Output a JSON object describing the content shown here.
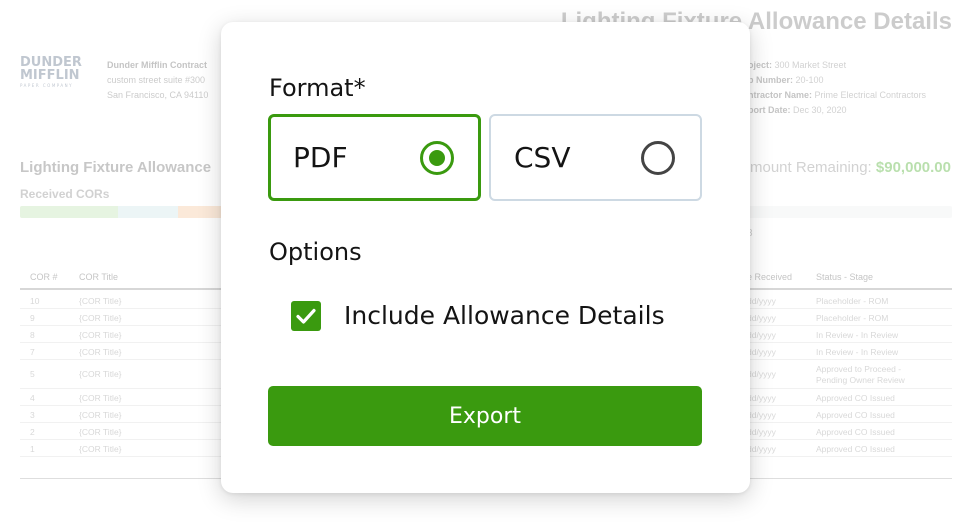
{
  "report": {
    "title": "Lighting Fixture Allowance Details",
    "logo": {
      "line1": "DUNDER",
      "line2": "MIFFLIN",
      "tagline": "PAPER COMPANY"
    },
    "company": {
      "name": "Dunder Mifflin Contract",
      "address1": "custom street suite #300",
      "address2": "San Francisco, CA 94110"
    },
    "meta": [
      {
        "label": "oject:",
        "value": "300 Market Street"
      },
      {
        "label": "b Number:",
        "value": "20-100"
      },
      {
        "label": "ntractor Name:",
        "value": "Prime Electrical Contractors"
      },
      {
        "label": "port Date:",
        "value": "Dec 30, 2020"
      }
    ],
    "section_title": "Lighting Fixture Allowance",
    "received_label": "Received CORs",
    "remaining_label": "mount Remaining:",
    "remaining_amount": "$90,000.00",
    "progress_colors": [
      "#bfe3b3",
      "#cfe6ea",
      "#f6c79e"
    ],
    "progress_values": [
      0.105,
      0.065,
      0.05
    ],
    "stray_char": "3",
    "columns": {
      "cor": "COR #",
      "title": "COR Title",
      "date": "e Received",
      "status": "Status - Stage"
    },
    "rows": [
      {
        "cor": "10",
        "title": "{COR Title}",
        "date": "dd/yyyy",
        "status": "Placeholder - ROM"
      },
      {
        "cor": "9",
        "title": "{COR Title}",
        "date": "dd/yyyy",
        "status": "Placeholder - ROM"
      },
      {
        "cor": "8",
        "title": "{COR Title}",
        "date": "dd/yyyy",
        "status": "In Review - In Review"
      },
      {
        "cor": "7",
        "title": "{COR Title}",
        "date": "dd/yyyy",
        "status": "In Review - In Review"
      },
      {
        "cor": "5",
        "title": "{COR Title}",
        "date": "dd/yyyy",
        "status": "Approved to Proceed -",
        "status2": "Pending Owner Review"
      },
      {
        "cor": "4",
        "title": "{COR Title}",
        "date": "dd/yyyy",
        "status": "Approved CO Issued"
      },
      {
        "cor": "3",
        "title": "{COR Title}",
        "date": "dd/yyyy",
        "status": "Approved CO Issued"
      },
      {
        "cor": "2",
        "title": "{COR Title}",
        "date": "dd/yyyy",
        "status": "Approved CO Issued"
      },
      {
        "cor": "1",
        "title": "{COR Title}",
        "date": "dd/yyyy",
        "status": "Approved CO Issued"
      }
    ]
  },
  "modal": {
    "format_label": "Format*",
    "formats": [
      {
        "label": "PDF",
        "selected": true
      },
      {
        "label": "CSV",
        "selected": false
      }
    ],
    "options_label": "Options",
    "include_details_label": "Include Allowance Details",
    "include_details_checked": true,
    "export_label": "Export",
    "accent_color": "#3a9a0f"
  }
}
